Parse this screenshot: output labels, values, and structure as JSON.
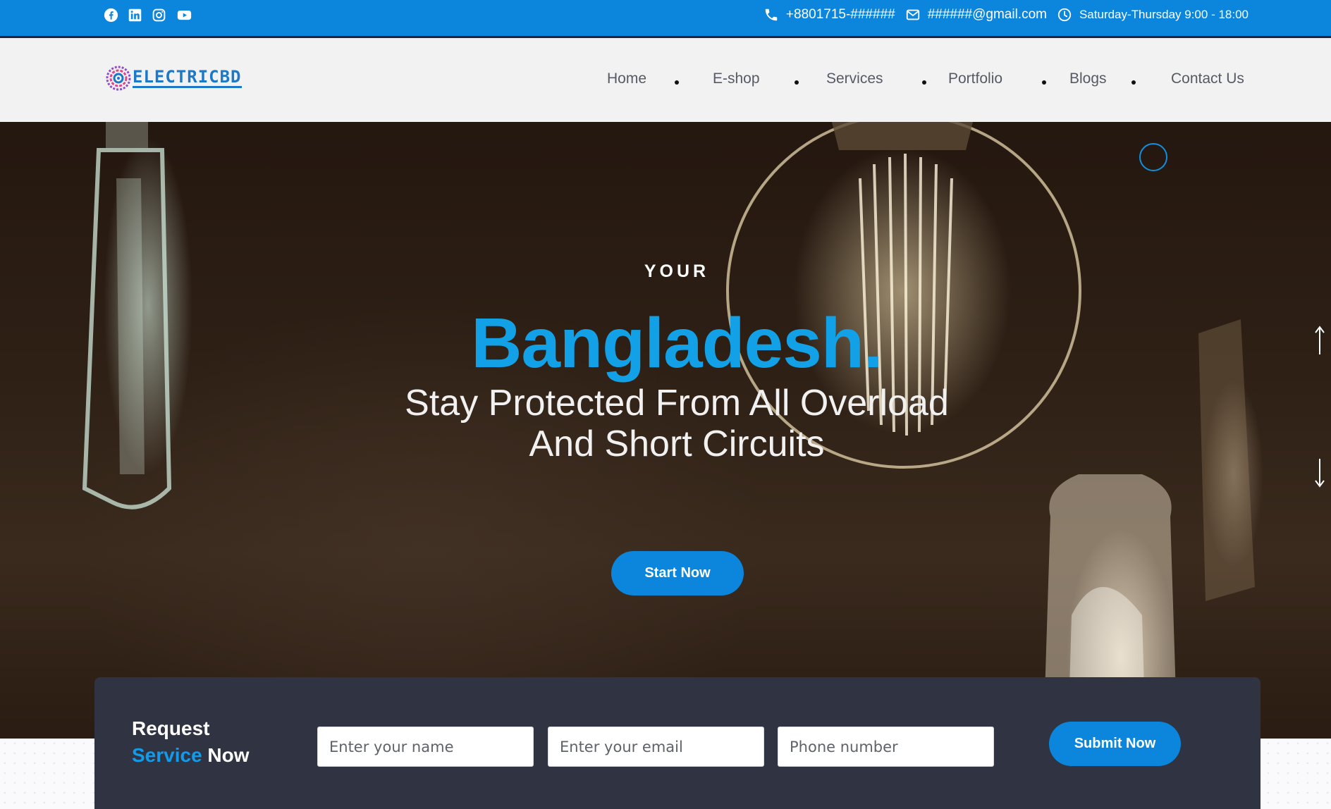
{
  "topbar": {
    "social": [
      {
        "icon": "facebook-icon"
      },
      {
        "icon": "linkedin-icon"
      },
      {
        "icon": "instagram-icon"
      },
      {
        "icon": "youtube-icon"
      }
    ],
    "phone": "+8801715-######",
    "email": "######@gmail.com",
    "hours": "Saturday-Thursday 9:00 - 18:00",
    "background_color": "#0b86dc"
  },
  "header": {
    "logo_text": "ELECTRICBD",
    "nav": [
      {
        "label": "Home"
      },
      {
        "label": "E-shop"
      },
      {
        "label": "Services"
      },
      {
        "label": "Portfolio"
      },
      {
        "label": "Blogs"
      },
      {
        "label": "Contact Us"
      }
    ]
  },
  "hero": {
    "eyebrow": "YOUR",
    "headline": "Bangladesh.",
    "tagline_line1": "Stay Protected From All Overload",
    "tagline_line2": "And Short Circuits",
    "cta_label": "Start Now",
    "accent_color": "#12a1e6"
  },
  "request": {
    "title_line1": "Request",
    "title_accent": "Service",
    "title_rest": "Now",
    "name_placeholder": "Enter your name",
    "email_placeholder": "Enter your email",
    "phone_placeholder": "Phone number",
    "submit_label": "Submit Now"
  }
}
